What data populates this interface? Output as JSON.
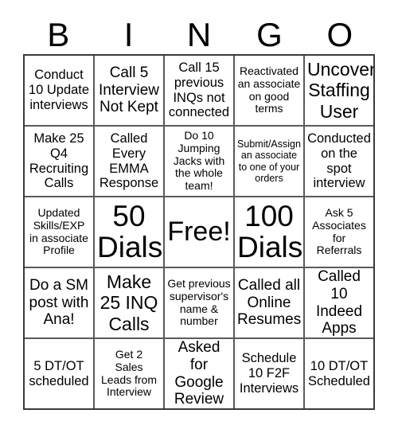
{
  "card": {
    "header_letters": [
      "B",
      "I",
      "N",
      "G",
      "O"
    ],
    "grid": [
      [
        {
          "text": "Conduct\n10 Update\ninterviews",
          "size": "m"
        },
        {
          "text": "Call 5\nInterview\nNot Kept",
          "size": "l"
        },
        {
          "text": "Call 15\nprevious\nINQs not\nconnected",
          "size": "m"
        },
        {
          "text": "Reactivated\nan associate\non good\nterms",
          "size": "s"
        },
        {
          "text": "Uncover\nStaffing\nUser",
          "size": "xl"
        }
      ],
      [
        {
          "text": "Make 25\nQ4\nRecruiting\nCalls",
          "size": "m"
        },
        {
          "text": "Called\nEvery\nEMMA\nResponse",
          "size": "m"
        },
        {
          "text": "Do 10\nJumping\nJacks with\nthe whole\nteam!",
          "size": "s"
        },
        {
          "text": "Submit/Assign\nan associate\nto one of your\norders",
          "size": "xs"
        },
        {
          "text": "Conducted\non the\nspot\ninterview",
          "size": "m"
        }
      ],
      [
        {
          "text": "Updated\nSkills/EXP\nin associate\nProfile",
          "size": "s"
        },
        {
          "text": "50\nDials",
          "size": "huge"
        },
        {
          "text": "Free!",
          "size": "free"
        },
        {
          "text": "100\nDials",
          "size": "huge"
        },
        {
          "text": "Ask 5\nAssociates\nfor\nReferrals",
          "size": "s"
        }
      ],
      [
        {
          "text": "Do a SM\npost with\nAna!",
          "size": "l"
        },
        {
          "text": "Make\n25 INQ\nCalls",
          "size": "xl"
        },
        {
          "text": "Get previous\nsupervisor's\nname &\nnumber",
          "size": "s"
        },
        {
          "text": "Called all\nOnline\nResumes",
          "size": "l"
        },
        {
          "text": "Called 10\nIndeed\nApps",
          "size": "l"
        }
      ],
      [
        {
          "text": "5 DT/OT\nscheduled",
          "size": "m"
        },
        {
          "text": "Get 2\nSales\nLeads from\nInterview",
          "size": "s"
        },
        {
          "text": "Asked for\nGoogle\nReview",
          "size": "l"
        },
        {
          "text": "Schedule\n10 F2F\nInterviews",
          "size": "m"
        },
        {
          "text": "10 DT/OT\nScheduled",
          "size": "m"
        }
      ]
    ],
    "free_space": {
      "row": 2,
      "col": 2,
      "label": "Free!"
    },
    "colors": {
      "background": "#ffffff",
      "text": "#000000",
      "grid_outer_border": "#3a3a3a",
      "grid_inner_border": "#5a5a5a"
    }
  }
}
